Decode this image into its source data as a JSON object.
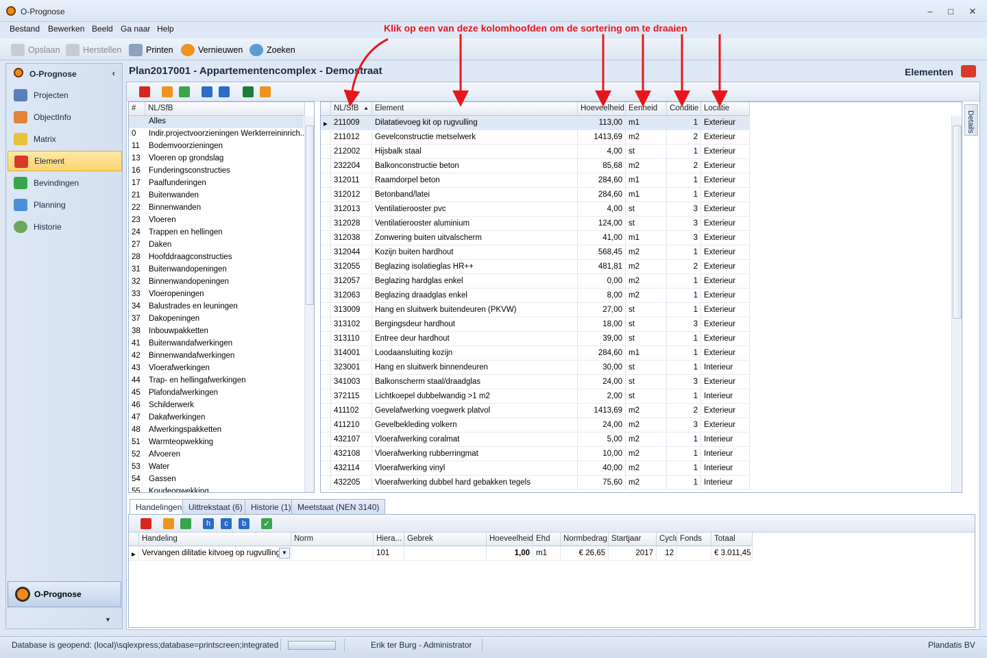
{
  "app": {
    "title": "O-Prognose"
  },
  "menu": [
    "Bestand",
    "Bewerken",
    "Beeld",
    "Ga naar",
    "Help"
  ],
  "toolbar": {
    "save": "Opslaan",
    "restore": "Herstellen",
    "print": "Printen",
    "refresh": "Vernieuwen",
    "search": "Zoeken"
  },
  "annotation": "Klik op een van deze kolomhoofden om de sortering om te draaien",
  "sidebar": {
    "header": "O-Prognose",
    "items": [
      "Projecten",
      "ObjectInfo",
      "Matrix",
      "Element",
      "Bevindingen",
      "Planning",
      "Historie"
    ],
    "active": "Element",
    "bottom": "O-Prognose"
  },
  "page": {
    "title": "Plan2017001 - Appartementencomplex - Demostraat",
    "section": "Elementen"
  },
  "leftlist": {
    "headers": [
      "#",
      "NL/SfB"
    ],
    "items": [
      [
        "",
        "Alles"
      ],
      [
        "0",
        "Indir.projectvoorzieningen Werkterreininrich..."
      ],
      [
        "11",
        "Bodemvoorzieningen"
      ],
      [
        "13",
        "Vloeren op grondslag"
      ],
      [
        "16",
        "Funderingsconstructies"
      ],
      [
        "17",
        "Paalfunderingen"
      ],
      [
        "21",
        "Buitenwanden"
      ],
      [
        "22",
        "Binnenwanden"
      ],
      [
        "23",
        "Vloeren"
      ],
      [
        "24",
        "Trappen en hellingen"
      ],
      [
        "27",
        "Daken"
      ],
      [
        "28",
        "Hoofddraagconstructies"
      ],
      [
        "31",
        "Buitenwandopeningen"
      ],
      [
        "32",
        "Binnenwandopeningen"
      ],
      [
        "33",
        "Vloeropeningen"
      ],
      [
        "34",
        "Balustrades en leuningen"
      ],
      [
        "37",
        "Dakopeningen"
      ],
      [
        "38",
        "Inbouwpakketten"
      ],
      [
        "41",
        "Buitenwandafwerkingen"
      ],
      [
        "42",
        "Binnenwandafwerkingen"
      ],
      [
        "43",
        "Vloerafwerkingen"
      ],
      [
        "44",
        "Trap- en hellingafwerkingen"
      ],
      [
        "45",
        "Plafondafwerkingen"
      ],
      [
        "46",
        "Schilderwerk"
      ],
      [
        "47",
        "Dakafwerkingen"
      ],
      [
        "48",
        "Afwerkingspakketten"
      ],
      [
        "51",
        "Warmteopwekking"
      ],
      [
        "52",
        "Afvoeren"
      ],
      [
        "53",
        "Water"
      ],
      [
        "54",
        "Gassen"
      ],
      [
        "55",
        "Koudeopwekking"
      ]
    ]
  },
  "elements": {
    "headers": [
      "NL/SfB",
      "Element",
      "Hoeveelheid",
      "Eenheid",
      "Conditie",
      "Locatie"
    ],
    "rows": [
      [
        "211009",
        "Dilatatievoeg kit op rugvulling",
        "113,00",
        "m1",
        "1",
        "Exterieur"
      ],
      [
        "211012",
        "Gevelconstructie metselwerk",
        "1413,69",
        "m2",
        "2",
        "Exterieur"
      ],
      [
        "212002",
        "Hijsbalk staal",
        "4,00",
        "st",
        "1",
        "Exterieur"
      ],
      [
        "232204",
        "Balkonconstructie beton",
        "85,68",
        "m2",
        "2",
        "Exterieur"
      ],
      [
        "312011",
        "Raamdorpel beton",
        "284,60",
        "m1",
        "1",
        "Exterieur"
      ],
      [
        "312012",
        "Betonband/latei",
        "284,60",
        "m1",
        "1",
        "Exterieur"
      ],
      [
        "312013",
        "Ventilatierooster pvc",
        "4,00",
        "st",
        "3",
        "Exterieur"
      ],
      [
        "312028",
        "Ventilatierooster aluminium",
        "124,00",
        "st",
        "3",
        "Exterieur"
      ],
      [
        "312038",
        "Zonwering buiten uitvalscherm",
        "41,00",
        "m1",
        "3",
        "Exterieur"
      ],
      [
        "312044",
        "Kozijn buiten hardhout",
        "568,45",
        "m2",
        "1",
        "Exterieur"
      ],
      [
        "312055",
        "Beglazing isolatieglas HR++",
        "481,81",
        "m2",
        "2",
        "Exterieur"
      ],
      [
        "312057",
        "Beglazing hardglas enkel",
        "0,00",
        "m2",
        "1",
        "Exterieur"
      ],
      [
        "312063",
        "Beglazing draadglas enkel",
        "8,00",
        "m2",
        "1",
        "Exterieur"
      ],
      [
        "313009",
        "Hang en sluitwerk buitendeuren (PKVW)",
        "27,00",
        "st",
        "1",
        "Exterieur"
      ],
      [
        "313102",
        "Bergingsdeur hardhout",
        "18,00",
        "st",
        "3",
        "Exterieur"
      ],
      [
        "313110",
        "Entree deur hardhout",
        "39,00",
        "st",
        "1",
        "Exterieur"
      ],
      [
        "314001",
        "Loodaansluiting kozijn",
        "284,60",
        "m1",
        "1",
        "Exterieur"
      ],
      [
        "323001",
        "Hang en sluitwerk binnendeuren",
        "30,00",
        "st",
        "1",
        "Interieur"
      ],
      [
        "341003",
        "Balkonscherm staal/draadglas",
        "24,00",
        "st",
        "3",
        "Exterieur"
      ],
      [
        "372115",
        "Lichtkoepel dubbelwandig >1 m2",
        "2,00",
        "st",
        "1",
        "Interieur"
      ],
      [
        "411102",
        "Gevelafwerking voegwerk platvol",
        "1413,69",
        "m2",
        "2",
        "Exterieur"
      ],
      [
        "411210",
        "Gevelbekleding volkern",
        "24,00",
        "m2",
        "3",
        "Exterieur"
      ],
      [
        "432107",
        "Vloerafwerking coralmat",
        "5,00",
        "m2",
        "1",
        "Interieur"
      ],
      [
        "432108",
        "Vloerafwerking rubberringmat",
        "10,00",
        "m2",
        "1",
        "Interieur"
      ],
      [
        "432114",
        "Vloerafwerking vinyl",
        "40,00",
        "m2",
        "1",
        "Interieur"
      ],
      [
        "432205",
        "Vloerafwerking dubbel hard gebakken tegels",
        "75,60",
        "m2",
        "1",
        "Interieur"
      ]
    ]
  },
  "details_tab": "Details",
  "tabs": [
    "Handelingen",
    "Uittrekstaat (6)",
    "Historie (1)",
    "Meetstaat (NEN 3140)"
  ],
  "actions": {
    "headers": [
      "Handeling",
      "Norm",
      "Hiera...",
      "Gebrek",
      "Hoeveelheid",
      "Ehd",
      "Normbedrag",
      "Startjaar",
      "Cyclus",
      "Fonds",
      "Totaal"
    ],
    "rows": [
      [
        "Vervangen dilitatie kitvoeg op rugvulling",
        "",
        "101",
        "",
        "1,00",
        "m1",
        "€ 26,65",
        "2017",
        "12",
        "",
        "€ 3.011,45"
      ]
    ]
  },
  "subtool_letters": [
    "h",
    "c",
    "b"
  ],
  "status": {
    "db": "Database is geopend: (local)\\sqlexpress;database=printscreen;integrated",
    "user": "Erik ter Burg - Administrator",
    "company": "Plandatis BV"
  }
}
